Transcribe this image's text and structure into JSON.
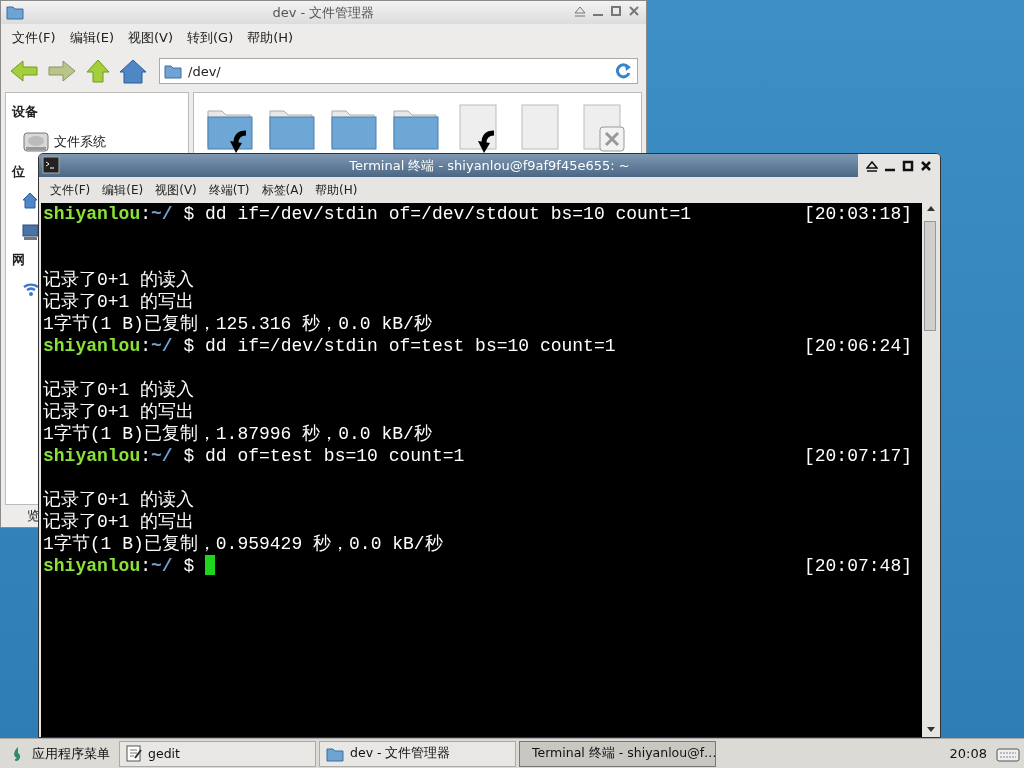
{
  "file_manager": {
    "title": "dev - 文件管理器",
    "menu": [
      "文件(F)",
      "编辑(E)",
      "视图(V)",
      "转到(G)",
      "帮助(H)"
    ],
    "path": "/dev/",
    "sidebar": [
      {
        "heading": "设备",
        "items": [
          {
            "kind": "drive",
            "label": "文件系统"
          }
        ]
      },
      {
        "heading": "位",
        "items": [
          {
            "kind": "home"
          },
          {
            "kind": "desktop"
          }
        ]
      },
      {
        "heading": "网",
        "items": [
          {
            "kind": "network"
          }
        ]
      }
    ],
    "files": [
      {
        "kind": "folder",
        "link": true
      },
      {
        "kind": "folder",
        "link": false
      },
      {
        "kind": "folder",
        "link": false
      },
      {
        "kind": "folder",
        "link": false
      },
      {
        "kind": "file",
        "link": true
      },
      {
        "kind": "file",
        "link": false
      },
      {
        "kind": "broken",
        "link": false
      }
    ],
    "status_text": "览"
  },
  "terminal": {
    "title": "Terminal 终端 - shiyanlou@f9af9f45e655: ~",
    "menu": [
      "文件(F)",
      "编辑(E)",
      "视图(V)",
      "终端(T)",
      "标签(A)",
      "帮助(H)"
    ],
    "lines": [
      {
        "kind": "prompt",
        "user": "shiyanlou",
        "separator": ":",
        "path": "~/",
        "command": "$ dd if=/dev/stdin of=/dev/stdout bs=10 count=1",
        "time": "[20:03:18]",
        "cursor": false
      },
      {
        "kind": "blank"
      },
      {
        "kind": "blank"
      },
      {
        "kind": "output",
        "text": "记录了0+1 的读入"
      },
      {
        "kind": "output",
        "text": "记录了0+1 的写出"
      },
      {
        "kind": "output",
        "text": "1字节(1 B)已复制，125.316 秒，0.0 kB/秒"
      },
      {
        "kind": "prompt",
        "user": "shiyanlou",
        "separator": ":",
        "path": "~/",
        "command": "$ dd if=/dev/stdin of=test bs=10 count=1",
        "time": "[20:06:24]",
        "cursor": false
      },
      {
        "kind": "blank"
      },
      {
        "kind": "output",
        "text": "记录了0+1 的读入"
      },
      {
        "kind": "output",
        "text": "记录了0+1 的写出"
      },
      {
        "kind": "output",
        "text": "1字节(1 B)已复制，1.87996 秒，0.0 kB/秒"
      },
      {
        "kind": "prompt",
        "user": "shiyanlou",
        "separator": ":",
        "path": "~/",
        "command": "$ dd of=test bs=10 count=1",
        "time": "[20:07:17]",
        "cursor": false
      },
      {
        "kind": "blank"
      },
      {
        "kind": "output",
        "text": "记录了0+1 的读入"
      },
      {
        "kind": "output",
        "text": "记录了0+1 的写出"
      },
      {
        "kind": "output",
        "text": "1字节(1 B)已复制，0.959429 秒，0.0 kB/秒"
      },
      {
        "kind": "prompt",
        "user": "shiyanlou",
        "separator": ":",
        "path": "~/",
        "command": "$",
        "time": "[20:07:48]",
        "cursor": true
      }
    ]
  },
  "taskbar": {
    "start": "应用程序菜单",
    "tasks": [
      {
        "kind": "editor",
        "label": "gedit",
        "selected": false
      },
      {
        "kind": "folder",
        "label": "dev - 文件管理器",
        "selected": false
      },
      {
        "kind": "terminal",
        "label": "Terminal 终端 - shiyanlou@f…",
        "selected": true
      }
    ],
    "clock": "20:08"
  }
}
